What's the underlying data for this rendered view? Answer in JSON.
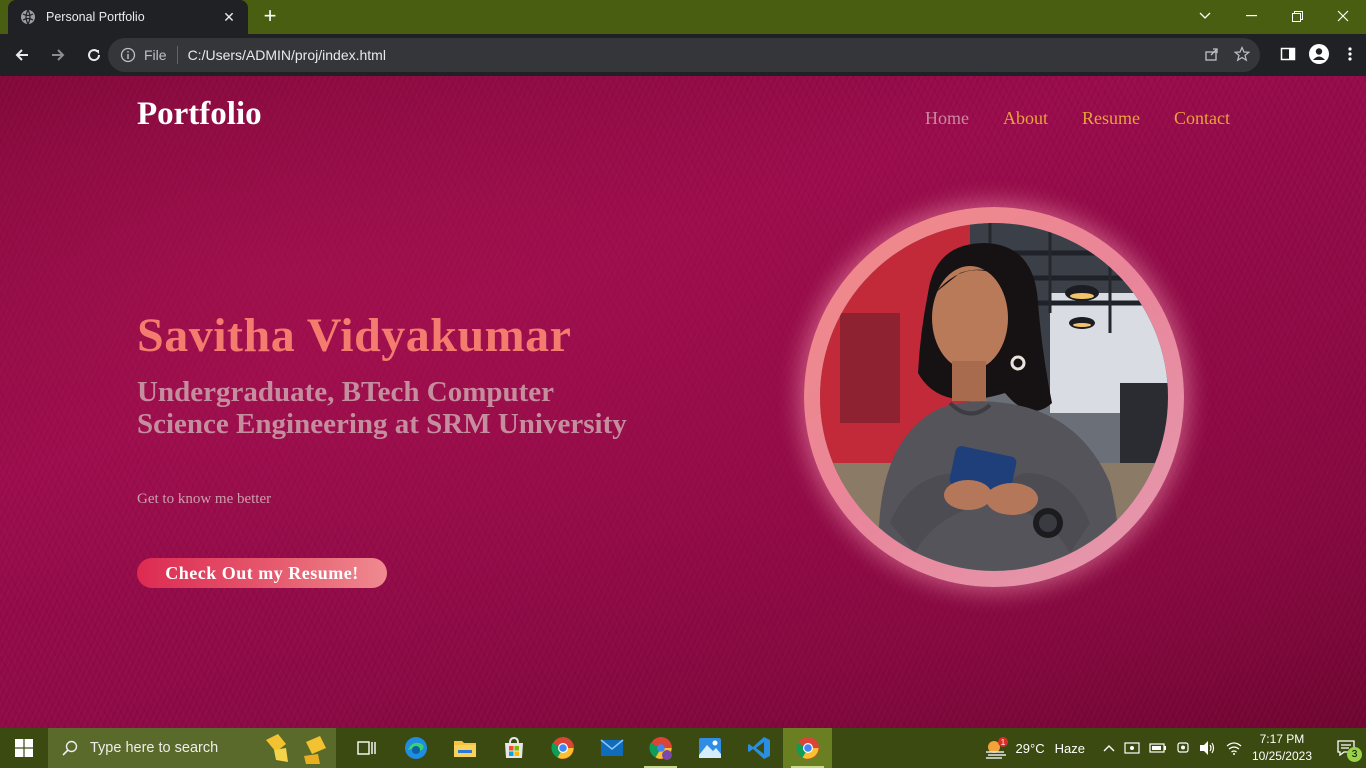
{
  "browser": {
    "tab_title": "Personal Portfolio",
    "address_file_label": "File",
    "url": "C:/Users/ADMIN/proj/index.html"
  },
  "site": {
    "brand": "Portfolio",
    "nav": [
      "Home",
      "About",
      "Resume",
      "Contact"
    ],
    "hero": {
      "name": "Savitha Vidyakumar",
      "subtitle": "Undergraduate, BTech Computer Science Engineering at SRM University",
      "tagline": "Get to know me better",
      "cta": "Check Out my Resume!"
    },
    "colors": {
      "name": "#f47c6e",
      "nav_link": "#e8a33a",
      "nav_home": "#c9899f",
      "cta_start": "#dd2a52",
      "background": "#8c0a45"
    }
  },
  "taskbar": {
    "search_placeholder": "Type here to search",
    "weather_temp": "29°C",
    "weather_desc": "Haze",
    "weather_badge": "1",
    "time": "7:17 PM",
    "date": "10/25/2023",
    "notification_count": "3",
    "apps": [
      "task-view-icon",
      "edge-icon",
      "file-explorer-icon",
      "store-icon",
      "chrome-icon",
      "mail-icon",
      "chrome-profile-icon",
      "photos-icon",
      "vscode-icon",
      "chrome-active-icon"
    ]
  }
}
